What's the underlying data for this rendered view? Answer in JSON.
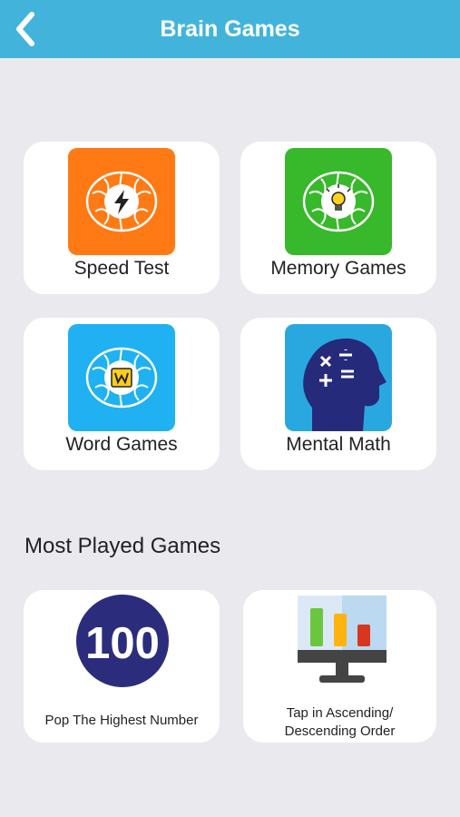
{
  "header": {
    "title": "Brain Games",
    "back_icon": "chevron-left-icon",
    "background": "#42b4dc"
  },
  "categories": [
    {
      "label": "Speed Test",
      "icon": "lightning-brain-icon",
      "color": "#ff7a14"
    },
    {
      "label": "Memory Games",
      "icon": "lightbulb-brain-icon",
      "color": "#38b82b"
    },
    {
      "label": "Word Games",
      "icon": "word-tile-brain-icon",
      "color": "#1fb1f2"
    },
    {
      "label": "Mental Math",
      "icon": "math-head-icon",
      "color": "#29a8e0"
    }
  ],
  "most_played": {
    "title": "Most Played Games",
    "games": [
      {
        "label": "Pop The Highest Number",
        "icon_text": "100",
        "icon": "number-circle-icon",
        "color": "#2b2d7c"
      },
      {
        "label_line1": "Tap in Ascending/",
        "label_line2": "Descending Order",
        "icon": "bar-chart-monitor-icon"
      }
    ]
  }
}
